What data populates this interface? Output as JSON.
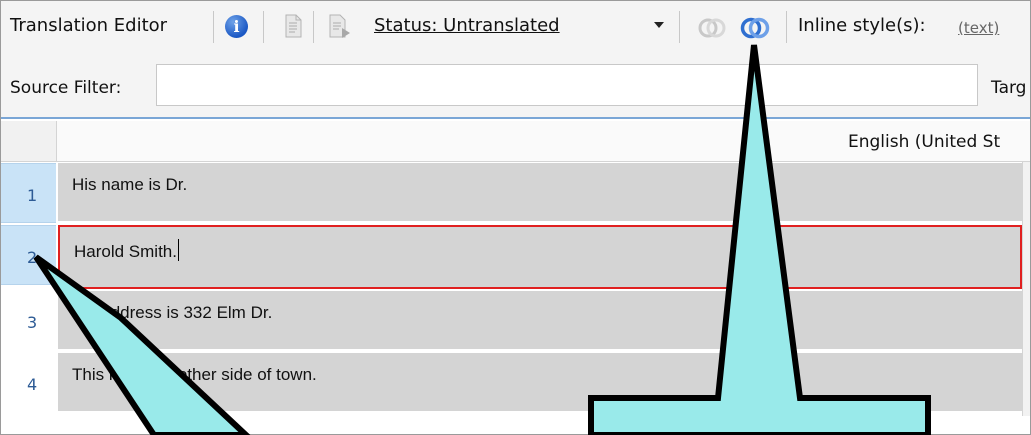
{
  "toolbar": {
    "title": "Translation Editor",
    "info_symbol": "i",
    "status_label": "Status: Untranslated",
    "inline_styles_label": "Inline style(s):",
    "text_link": "(text)"
  },
  "filter": {
    "source_label": "Source Filter:",
    "source_value": "",
    "target_label_partial": "Targ"
  },
  "grid": {
    "column_header": "English (United St",
    "rows": [
      {
        "number": "1",
        "text": "His name is Dr."
      },
      {
        "number": "2",
        "text": "Harold Smith."
      },
      {
        "number": "3",
        "text": "His address is 332 Elm Dr."
      },
      {
        "number": "4",
        "text": "This is on the other side of town."
      }
    ],
    "selected_row": "2"
  },
  "colors": {
    "callout_fill": "#99eaea",
    "active_border": "#e02020",
    "selected_row_bg": "#c9e3f7",
    "segment_bg": "#d4d4d4"
  },
  "icons": [
    "info-icon",
    "move-up-document-icon",
    "move-down-document-icon",
    "dropdown-arrow-icon",
    "overlap-rings-gray-icon",
    "overlap-rings-blue-icon"
  ]
}
